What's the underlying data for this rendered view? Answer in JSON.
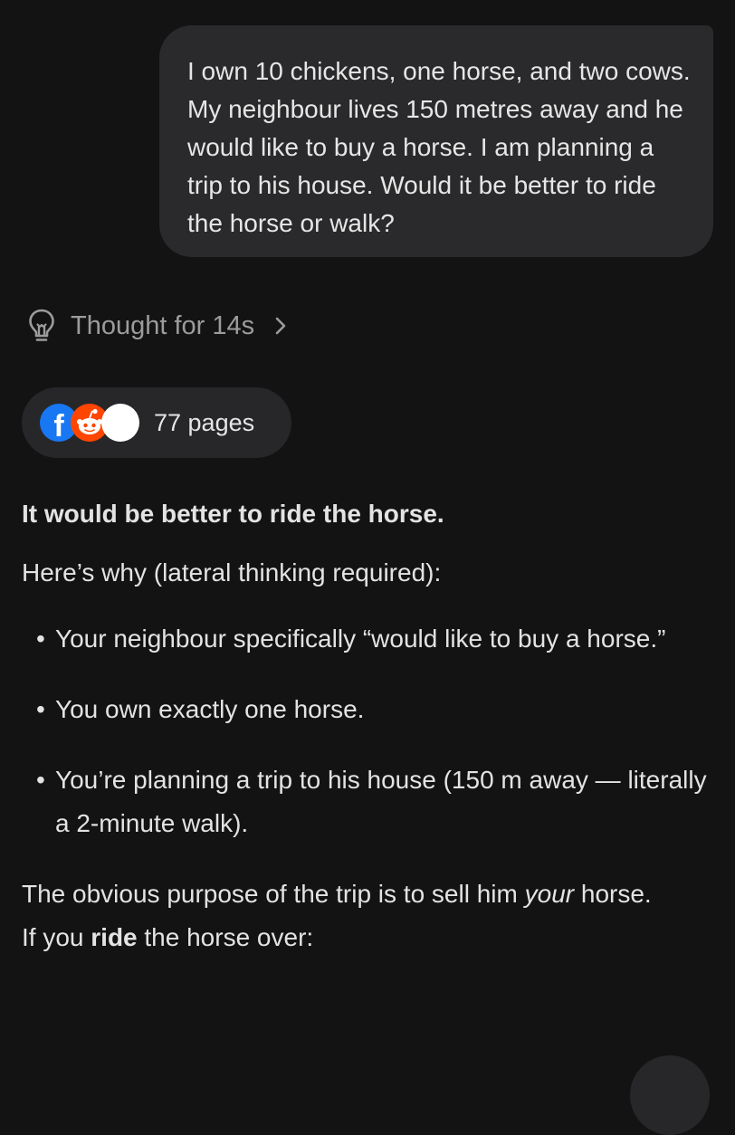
{
  "user_message": {
    "text": "I own 10 chickens, one horse, and two cows. My neighbour lives 150 metres away and he would like to buy a horse. I am planning a trip to his house. Would it be better to ride the horse or walk?"
  },
  "thought": {
    "label": "Thought for 14s",
    "icon": "lightbulb-icon"
  },
  "sources": {
    "label": "77 pages",
    "favicons": [
      "facebook-icon",
      "reddit-icon",
      "site-icon"
    ],
    "facebook_glyph": "f"
  },
  "answer": {
    "headline": "It would be better to ride the horse.",
    "intro": "Here’s why (lateral thinking required):",
    "bullets": [
      "Your neighbour specifically “would like to buy a horse.”",
      "You own exactly one horse.",
      "You’re planning a trip to his house (150 m away — literally a 2-minute walk)."
    ],
    "purpose_before": "The obvious purpose of the trip is to sell him ",
    "purpose_emphasis": "your",
    "purpose_after": " horse.",
    "ride_before": "If you ",
    "ride_emphasis": "ride",
    "ride_after": " the horse over:"
  },
  "colors": {
    "background": "#131314",
    "bubble": "#2a2a2c",
    "pill": "#27272a",
    "muted_text": "#9c9c9c",
    "facebook_blue": "#1877f2",
    "reddit_orange": "#ff4500"
  }
}
